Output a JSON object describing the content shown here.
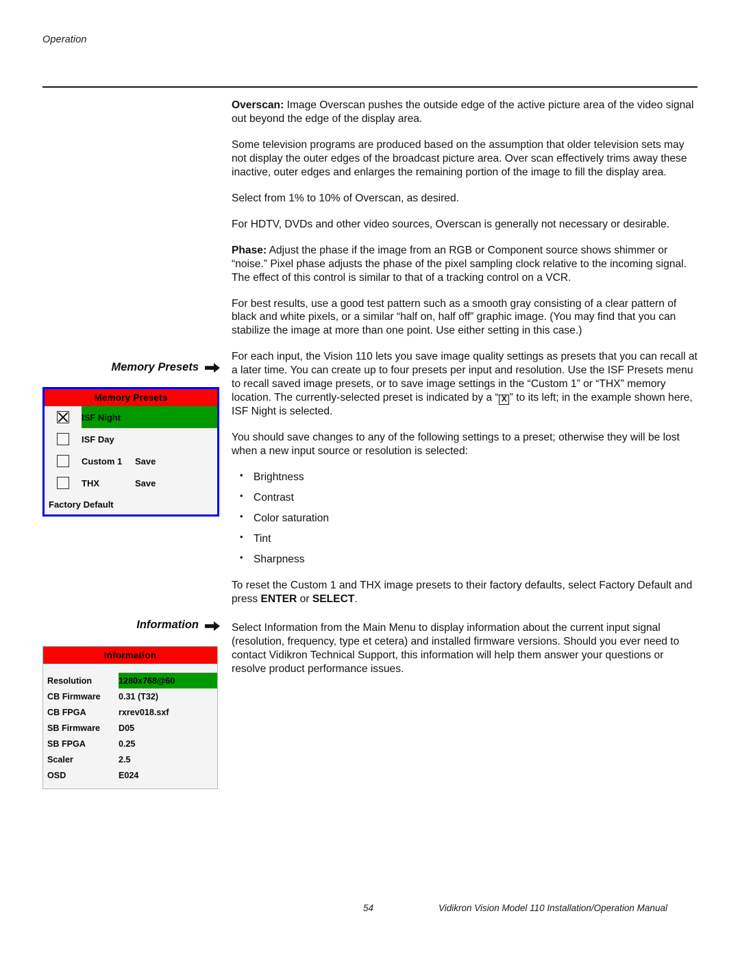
{
  "page": {
    "running_head": "Operation",
    "page_number": "54",
    "footer_title": "Vidikron Vision Model 110 Installation/Operation Manual"
  },
  "body": {
    "overscan": {
      "lead": "Overscan:",
      "text": " Image Overscan pushes the outside edge of the active picture area of the video signal out beyond the edge of the display area."
    },
    "overscan_detail": "Some television programs are produced based on the assumption that older television sets may not display the outer edges of the broadcast picture area. Over scan effectively trims away these inactive, outer edges and enlarges the remaining portion of the image to fill the display area.",
    "overscan_range": "Select from 1% to 10% of Overscan, as desired.",
    "overscan_hdtv": "For HDTV, DVDs and other video sources, Overscan is generally not necessary or desirable.",
    "phase": {
      "lead": "Phase:",
      "text": " Adjust the phase if the image from an RGB or Component source shows shimmer or “noise.” Pixel phase adjusts the phase of the pixel sampling clock relative to the incoming signal. The effect of this control is similar to that of a tracking control on a VCR."
    },
    "phase_detail": "For best results, use a good test pattern such as a smooth gray consisting of a clear pattern of black and white pixels, or a similar “half on, half off” graphic image. (You may find that you can stabilize the image at more than one point. Use either setting in this case.)",
    "presets_intro_a": "For each input, the Vision 110 lets you save image quality settings as presets that you can recall at a later time. You can create up to four presets per input and resolution. Use the ISF Presets menu to recall saved image presets, or to save image settings in the “Custom 1” or “THX” memory location. The currently-selected preset is indicated by a “",
    "presets_intro_glyph": "X",
    "presets_intro_b": "” to its left; in the example shown here, ISF Night is selected.",
    "presets_save_warning": "You should save changes to any of the following settings to a preset; otherwise they will be lost when a new input source or resolution is selected:",
    "settings_bullets": [
      "Brightness",
      "Contrast",
      "Color saturation",
      "Tint",
      "Sharpness"
    ],
    "factory_reset": {
      "part1": "To reset the Custom 1 and THX image presets to their factory defaults, select Factory Default and press ",
      "enter": "ENTER",
      "conj": " or ",
      "select": "SELECT",
      "part2": "."
    },
    "information_para": "Select Information from the Main Menu to display information about the current input signal (resolution, frequency, type et cetera) and installed firmware versions. Should you ever need to contact Vidikron Technical Support, this information will help them answer your questions or resolve product performance issues."
  },
  "callouts": {
    "memory_presets_label": "Memory Presets",
    "information_label": "Information"
  },
  "memory_presets_menu": {
    "title": "Memory Presets",
    "rows": [
      {
        "name": "ISF Night",
        "checked": true,
        "selected": true,
        "save": ""
      },
      {
        "name": "ISF Day",
        "checked": false,
        "selected": false,
        "save": ""
      },
      {
        "name": "Custom 1",
        "checked": false,
        "selected": false,
        "save": "Save"
      },
      {
        "name": "THX",
        "checked": false,
        "selected": false,
        "save": "Save"
      }
    ],
    "factory_default": "Factory Default",
    "colors": {
      "title_bar": "#ff0000",
      "highlight": "#009900",
      "border": "#0000ff",
      "background": "#f4f4f4"
    }
  },
  "information_menu": {
    "title": "Information",
    "rows": [
      {
        "key": "Resolution",
        "value": "1280x768@60",
        "highlight": true
      },
      {
        "key": "CB Firmware",
        "value": "0.31 (T32)",
        "highlight": false
      },
      {
        "key": "CB FPGA",
        "value": "rxrev018.sxf",
        "highlight": false
      },
      {
        "key": "SB Firmware",
        "value": "D05",
        "highlight": false
      },
      {
        "key": "SB FPGA",
        "value": "0.25",
        "highlight": false
      },
      {
        "key": "Scaler",
        "value": "2.5",
        "highlight": false
      },
      {
        "key": "OSD",
        "value": "E024",
        "highlight": false
      }
    ],
    "colors": {
      "title_bar": "#ff0000",
      "highlight": "#009900",
      "border": "#b8b8b8",
      "background": "#f4f4f4"
    }
  }
}
